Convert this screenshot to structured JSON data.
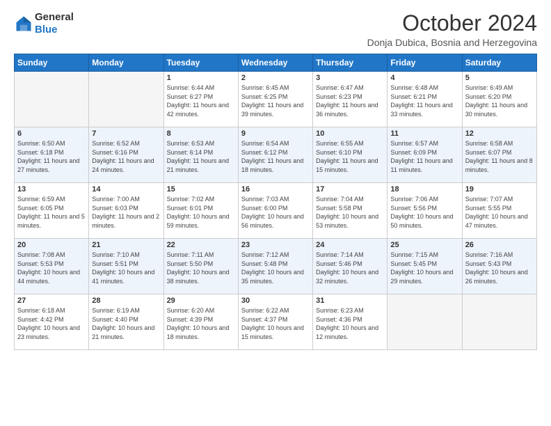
{
  "header": {
    "logo": {
      "general": "General",
      "blue": "Blue"
    },
    "month_year": "October 2024",
    "location": "Donja Dubica, Bosnia and Herzegovina"
  },
  "weekdays": [
    "Sunday",
    "Monday",
    "Tuesday",
    "Wednesday",
    "Thursday",
    "Friday",
    "Saturday"
  ],
  "weeks": [
    [
      {
        "day": "",
        "sunrise": "",
        "sunset": "",
        "daylight": ""
      },
      {
        "day": "",
        "sunrise": "",
        "sunset": "",
        "daylight": ""
      },
      {
        "day": "1",
        "sunrise": "Sunrise: 6:44 AM",
        "sunset": "Sunset: 6:27 PM",
        "daylight": "Daylight: 11 hours and 42 minutes."
      },
      {
        "day": "2",
        "sunrise": "Sunrise: 6:45 AM",
        "sunset": "Sunset: 6:25 PM",
        "daylight": "Daylight: 11 hours and 39 minutes."
      },
      {
        "day": "3",
        "sunrise": "Sunrise: 6:47 AM",
        "sunset": "Sunset: 6:23 PM",
        "daylight": "Daylight: 11 hours and 36 minutes."
      },
      {
        "day": "4",
        "sunrise": "Sunrise: 6:48 AM",
        "sunset": "Sunset: 6:21 PM",
        "daylight": "Daylight: 11 hours and 33 minutes."
      },
      {
        "day": "5",
        "sunrise": "Sunrise: 6:49 AM",
        "sunset": "Sunset: 6:20 PM",
        "daylight": "Daylight: 11 hours and 30 minutes."
      }
    ],
    [
      {
        "day": "6",
        "sunrise": "Sunrise: 6:50 AM",
        "sunset": "Sunset: 6:18 PM",
        "daylight": "Daylight: 11 hours and 27 minutes."
      },
      {
        "day": "7",
        "sunrise": "Sunrise: 6:52 AM",
        "sunset": "Sunset: 6:16 PM",
        "daylight": "Daylight: 11 hours and 24 minutes."
      },
      {
        "day": "8",
        "sunrise": "Sunrise: 6:53 AM",
        "sunset": "Sunset: 6:14 PM",
        "daylight": "Daylight: 11 hours and 21 minutes."
      },
      {
        "day": "9",
        "sunrise": "Sunrise: 6:54 AM",
        "sunset": "Sunset: 6:12 PM",
        "daylight": "Daylight: 11 hours and 18 minutes."
      },
      {
        "day": "10",
        "sunrise": "Sunrise: 6:55 AM",
        "sunset": "Sunset: 6:10 PM",
        "daylight": "Daylight: 11 hours and 15 minutes."
      },
      {
        "day": "11",
        "sunrise": "Sunrise: 6:57 AM",
        "sunset": "Sunset: 6:09 PM",
        "daylight": "Daylight: 11 hours and 11 minutes."
      },
      {
        "day": "12",
        "sunrise": "Sunrise: 6:58 AM",
        "sunset": "Sunset: 6:07 PM",
        "daylight": "Daylight: 11 hours and 8 minutes."
      }
    ],
    [
      {
        "day": "13",
        "sunrise": "Sunrise: 6:59 AM",
        "sunset": "Sunset: 6:05 PM",
        "daylight": "Daylight: 11 hours and 5 minutes."
      },
      {
        "day": "14",
        "sunrise": "Sunrise: 7:00 AM",
        "sunset": "Sunset: 6:03 PM",
        "daylight": "Daylight: 11 hours and 2 minutes."
      },
      {
        "day": "15",
        "sunrise": "Sunrise: 7:02 AM",
        "sunset": "Sunset: 6:01 PM",
        "daylight": "Daylight: 10 hours and 59 minutes."
      },
      {
        "day": "16",
        "sunrise": "Sunrise: 7:03 AM",
        "sunset": "Sunset: 6:00 PM",
        "daylight": "Daylight: 10 hours and 56 minutes."
      },
      {
        "day": "17",
        "sunrise": "Sunrise: 7:04 AM",
        "sunset": "Sunset: 5:58 PM",
        "daylight": "Daylight: 10 hours and 53 minutes."
      },
      {
        "day": "18",
        "sunrise": "Sunrise: 7:06 AM",
        "sunset": "Sunset: 5:56 PM",
        "daylight": "Daylight: 10 hours and 50 minutes."
      },
      {
        "day": "19",
        "sunrise": "Sunrise: 7:07 AM",
        "sunset": "Sunset: 5:55 PM",
        "daylight": "Daylight: 10 hours and 47 minutes."
      }
    ],
    [
      {
        "day": "20",
        "sunrise": "Sunrise: 7:08 AM",
        "sunset": "Sunset: 5:53 PM",
        "daylight": "Daylight: 10 hours and 44 minutes."
      },
      {
        "day": "21",
        "sunrise": "Sunrise: 7:10 AM",
        "sunset": "Sunset: 5:51 PM",
        "daylight": "Daylight: 10 hours and 41 minutes."
      },
      {
        "day": "22",
        "sunrise": "Sunrise: 7:11 AM",
        "sunset": "Sunset: 5:50 PM",
        "daylight": "Daylight: 10 hours and 38 minutes."
      },
      {
        "day": "23",
        "sunrise": "Sunrise: 7:12 AM",
        "sunset": "Sunset: 5:48 PM",
        "daylight": "Daylight: 10 hours and 35 minutes."
      },
      {
        "day": "24",
        "sunrise": "Sunrise: 7:14 AM",
        "sunset": "Sunset: 5:46 PM",
        "daylight": "Daylight: 10 hours and 32 minutes."
      },
      {
        "day": "25",
        "sunrise": "Sunrise: 7:15 AM",
        "sunset": "Sunset: 5:45 PM",
        "daylight": "Daylight: 10 hours and 29 minutes."
      },
      {
        "day": "26",
        "sunrise": "Sunrise: 7:16 AM",
        "sunset": "Sunset: 5:43 PM",
        "daylight": "Daylight: 10 hours and 26 minutes."
      }
    ],
    [
      {
        "day": "27",
        "sunrise": "Sunrise: 6:18 AM",
        "sunset": "Sunset: 4:42 PM",
        "daylight": "Daylight: 10 hours and 23 minutes."
      },
      {
        "day": "28",
        "sunrise": "Sunrise: 6:19 AM",
        "sunset": "Sunset: 4:40 PM",
        "daylight": "Daylight: 10 hours and 21 minutes."
      },
      {
        "day": "29",
        "sunrise": "Sunrise: 6:20 AM",
        "sunset": "Sunset: 4:39 PM",
        "daylight": "Daylight: 10 hours and 18 minutes."
      },
      {
        "day": "30",
        "sunrise": "Sunrise: 6:22 AM",
        "sunset": "Sunset: 4:37 PM",
        "daylight": "Daylight: 10 hours and 15 minutes."
      },
      {
        "day": "31",
        "sunrise": "Sunrise: 6:23 AM",
        "sunset": "Sunset: 4:36 PM",
        "daylight": "Daylight: 10 hours and 12 minutes."
      },
      {
        "day": "",
        "sunrise": "",
        "sunset": "",
        "daylight": ""
      },
      {
        "day": "",
        "sunrise": "",
        "sunset": "",
        "daylight": ""
      }
    ]
  ]
}
